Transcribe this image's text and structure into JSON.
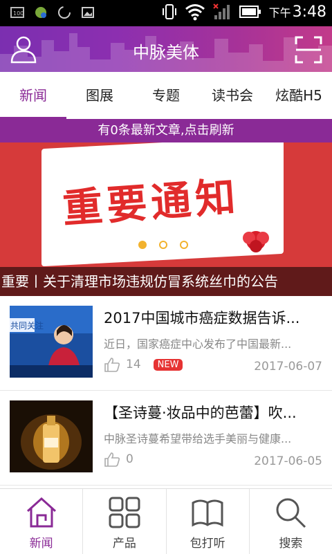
{
  "statusbar": {
    "time_prefix": "下午",
    "time": "3:48",
    "icons": [
      "sd-card-icon",
      "app-icon",
      "loading-icon",
      "image-icon",
      "vibrate-icon",
      "wifi-icon",
      "signal-icon",
      "battery-icon"
    ]
  },
  "header": {
    "title": "中脉美体",
    "left_icon": "user-icon",
    "right_icon": "scan-icon"
  },
  "tabs": [
    {
      "label": "新闻",
      "active": true
    },
    {
      "label": "图展",
      "active": false
    },
    {
      "label": "专题",
      "active": false
    },
    {
      "label": "读书会",
      "active": false
    },
    {
      "label": "炫酷H5",
      "active": false
    }
  ],
  "refresh_bar": "有0条最新文章,点击刷新",
  "banner": {
    "image_text": "重要通知",
    "caption": "重要丨关于清理市场违规仿冒系统丝巾的公告",
    "slides": 3,
    "active_slide": 1
  },
  "news": [
    {
      "title": "2017中国城市癌症数据告诉...",
      "desc": "近日，国家癌症中心发布了中国最新...",
      "likes": "14",
      "badge": "NEW",
      "date": "2017-06-07",
      "thumb_text": "共同关注"
    },
    {
      "title": "【圣诗蔓·妆品中的芭蕾】吹...",
      "desc": "中脉圣诗蔓希望带给选手美丽与健康...",
      "likes": "0",
      "badge": "",
      "date": "2017-06-05"
    }
  ],
  "bottom_nav": [
    {
      "label": "新闻",
      "icon": "home-icon",
      "active": true
    },
    {
      "label": "产品",
      "icon": "grid-icon",
      "active": false
    },
    {
      "label": "包打听",
      "icon": "book-icon",
      "active": false
    },
    {
      "label": "搜索",
      "icon": "search-icon",
      "active": false
    }
  ],
  "colors": {
    "accent": "#8a2a96",
    "badge": "#e63333",
    "banner_red": "#d63a3a",
    "dot": "#f2b22e"
  }
}
